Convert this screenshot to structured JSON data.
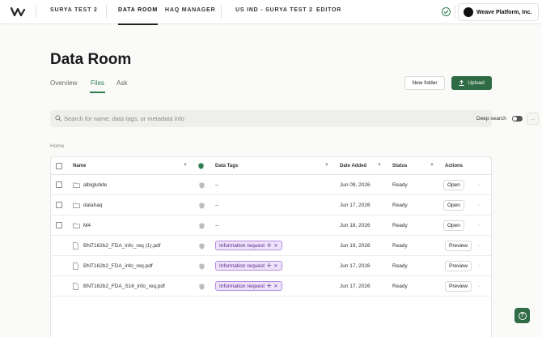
{
  "nav": {
    "links": [
      "SURYA TEST 2",
      "DATA ROOM",
      "HAQ MANAGER",
      "US IND - SURYA TEST 2",
      "EDITOR"
    ],
    "active": "DATA ROOM",
    "org_name": "Weave Platform, Inc."
  },
  "page": {
    "title": "Data Room",
    "tabs": [
      "Overview",
      "Files",
      "Ask"
    ],
    "active_tab": "Files",
    "new_folder_label": "New folder",
    "upload_label": "Upload"
  },
  "search": {
    "placeholder": "Search for name, data tags, or metadata info",
    "deep_search_label": "Deep search",
    "deep_search_on": false
  },
  "breadcrumb": "Home",
  "table": {
    "columns": [
      "Name",
      "Data Tags",
      "Date Added",
      "Status",
      "Actions"
    ],
    "rows": [
      {
        "type": "folder",
        "name": "albiglutide",
        "tags": "--",
        "date": "Jun 09, 2026",
        "status": "Ready",
        "action": "Open"
      },
      {
        "type": "folder",
        "name": "datahaq",
        "tags": "--",
        "date": "Jun 17, 2026",
        "status": "Ready",
        "action": "Open"
      },
      {
        "type": "folder",
        "name": "M4",
        "tags": "--",
        "date": "Jun 18, 2026",
        "status": "Ready",
        "action": "Open"
      },
      {
        "type": "file",
        "name": "BNT162b2_FDA_info_req (1).pdf",
        "tag": "Information request",
        "date": "Jun 19, 2026",
        "status": "Ready",
        "action": "Preview"
      },
      {
        "type": "file",
        "name": "BNT162b2_FDA_info_req.pdf",
        "tag": "Information request",
        "date": "Jun 17, 2026",
        "status": "Ready",
        "action": "Preview"
      },
      {
        "type": "file",
        "name": "BNT162b2_FDA_S16_info_req.pdf",
        "tag": "Information request",
        "date": "Jun 17, 2026",
        "status": "Ready",
        "action": "Preview"
      }
    ]
  },
  "colors": {
    "accent": "#2f6b45",
    "tag_bg": "#efe2fb",
    "tag_border": "#b48be0"
  }
}
